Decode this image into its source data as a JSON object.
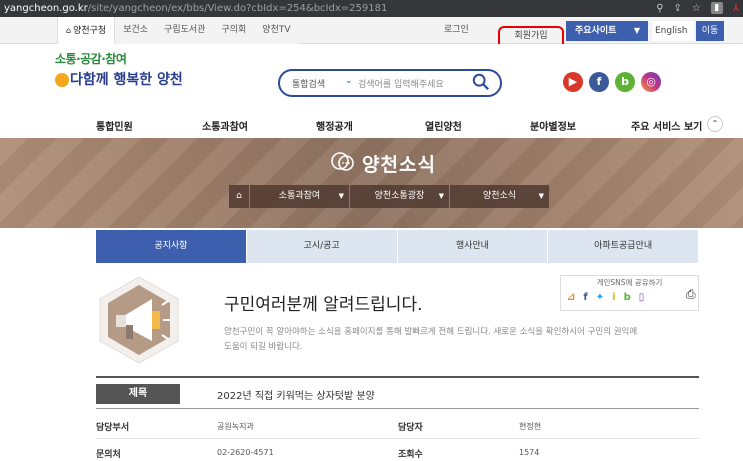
{
  "browser": {
    "url_host": "yangcheon.go.kr",
    "url_path": "/site/yangcheon/ex/bbs/View.do?cbIdx=254&bcIdx=259181"
  },
  "topnav": {
    "tabs": [
      "양천구청",
      "보건소",
      "구립도서관",
      "구의회",
      "양천TV"
    ],
    "login": "로그인",
    "join": "회원가입",
    "main_site": "주요사이트",
    "language": "English",
    "go": "이동"
  },
  "logo": {
    "line1": "소통·공감·참여",
    "line2": "다함께 행복한 양천"
  },
  "search": {
    "scope": "통합검색",
    "placeholder": "검색어를 입력해주세요"
  },
  "sns_top": [
    {
      "icon": "youtube-icon",
      "glyph": "▶",
      "color": "#d9372a"
    },
    {
      "icon": "facebook-icon",
      "glyph": "f",
      "color": "#3b5998"
    },
    {
      "icon": "blog-icon",
      "glyph": "b",
      "color": "#5fb236"
    },
    {
      "icon": "instagram-icon",
      "glyph": "◎",
      "color": "#c13584"
    }
  ],
  "gnb": [
    "통합민원",
    "소통과참여",
    "행정공개",
    "열린양천",
    "분야별정보",
    "주요 서비스 보기"
  ],
  "banner": {
    "title": "양천소식"
  },
  "breadcrumb": [
    "소통과참여",
    "양천소통광장",
    "양천소식"
  ],
  "subtabs": [
    "공지사항",
    "고시/공고",
    "행사안내",
    "아파트공급안내"
  ],
  "notice": {
    "heading": "구민여러분께 알려드립니다.",
    "desc": "양천구민이 꼭 알아야하는 소식을 홈페이지를 통해 발빠르게 전해 드립니다. 새로운 소식을 확인하시어 구민의 권익에 도움이 되길 바랍니다."
  },
  "share": {
    "label": "게인SNS에 공유하기"
  },
  "detail": {
    "title_label": "제목",
    "title": "2022년 직접 키워먹는 상자텃밭 분양",
    "dept_label": "담당부서",
    "dept": "공원녹지과",
    "manager_label": "담당자",
    "manager": "현정현",
    "contact_label": "문의처",
    "contact": "02-2620-4571",
    "views_label": "조회수",
    "views": "1574"
  },
  "colors": {
    "primary": "#3d5fae",
    "highlight": "#ee0000",
    "banner": "#9f7f6a"
  }
}
